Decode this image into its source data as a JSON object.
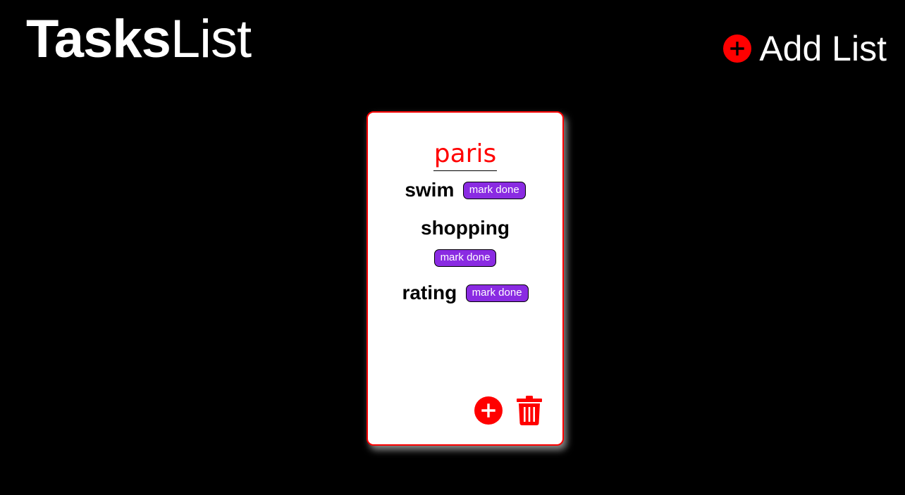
{
  "header": {
    "brand_bold": "Tasks",
    "brand_light": "List",
    "add_list_label": "Add List"
  },
  "list": {
    "title": "paris",
    "tasks": [
      {
        "name": "swim",
        "action_label": "mark done"
      },
      {
        "name": "shopping",
        "action_label": "mark done"
      },
      {
        "name": "rating",
        "action_label": "mark done"
      }
    ]
  },
  "colors": {
    "background": "#000000",
    "accent": "#ff0000",
    "button": "#8a2be2"
  },
  "icons": {
    "add_list": "plus-circle-icon",
    "add_task": "plus-circle-icon",
    "delete_list": "trash-icon"
  }
}
